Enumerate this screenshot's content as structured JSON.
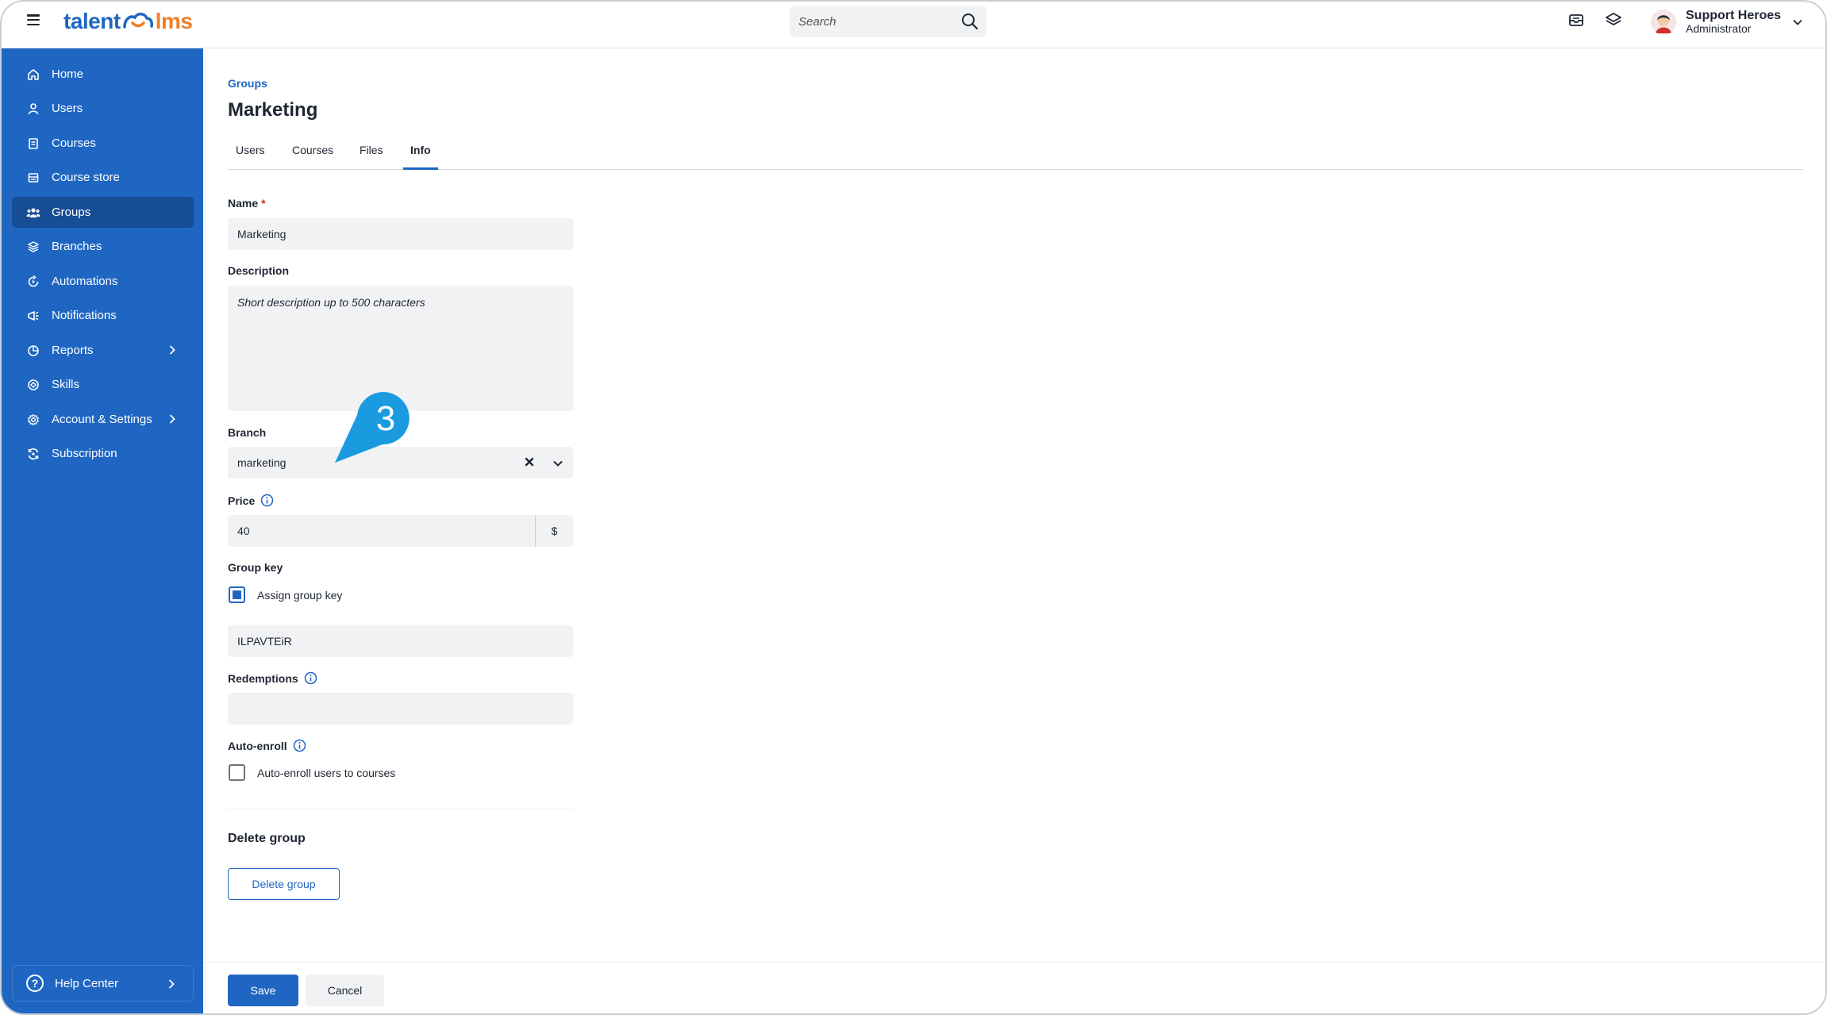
{
  "app": {
    "logo_part1": "talent",
    "logo_part2": "lms",
    "brand_color": "#1f66c2",
    "accent_color": "#f07e26"
  },
  "search": {
    "placeholder": "Search",
    "icon": "search-icon"
  },
  "user": {
    "name": "Support Heroes",
    "role": "Administrator"
  },
  "sidebar": {
    "items": [
      {
        "label": "Home",
        "icon": "home-icon"
      },
      {
        "label": "Users",
        "icon": "user-icon"
      },
      {
        "label": "Courses",
        "icon": "courses-icon"
      },
      {
        "label": "Course store",
        "icon": "course-store-icon"
      },
      {
        "label": "Groups",
        "icon": "groups-icon",
        "active": true
      },
      {
        "label": "Branches",
        "icon": "branches-icon"
      },
      {
        "label": "Automations",
        "icon": "automations-icon"
      },
      {
        "label": "Notifications",
        "icon": "notifications-icon"
      },
      {
        "label": "Reports",
        "icon": "reports-icon",
        "expandable": true
      },
      {
        "label": "Skills",
        "icon": "skills-icon"
      },
      {
        "label": "Account & Settings",
        "icon": "settings-icon",
        "expandable": true
      },
      {
        "label": "Subscription",
        "icon": "subscription-icon"
      }
    ],
    "help": "Help Center"
  },
  "page": {
    "breadcrumb": "Groups",
    "title": "Marketing",
    "tabs": [
      {
        "label": "Users"
      },
      {
        "label": "Courses"
      },
      {
        "label": "Files"
      },
      {
        "label": "Info",
        "active": true
      }
    ]
  },
  "form": {
    "name_label": "Name",
    "name_required": "*",
    "name_value": "Marketing",
    "description_label": "Description",
    "description_placeholder": "Short description up to 500 characters",
    "branch_label": "Branch",
    "branch_value": "marketing",
    "price_label": "Price",
    "price_value": "40",
    "currency": "$",
    "group_key_label": "Group key",
    "assign_key_label": "Assign group key",
    "assign_key_checked": true,
    "group_key_value": "ILPAVTEiR",
    "redemptions_label": "Redemptions",
    "redemptions_value": "",
    "auto_enroll_label": "Auto-enroll",
    "auto_enroll_checkbox_label": "Auto-enroll users to courses",
    "auto_enroll_checked": false
  },
  "delete_section": {
    "title": "Delete group",
    "button": "Delete group"
  },
  "footer": {
    "save": "Save",
    "cancel": "Cancel"
  },
  "callout": {
    "number": "3",
    "color": "#1a9be0"
  }
}
